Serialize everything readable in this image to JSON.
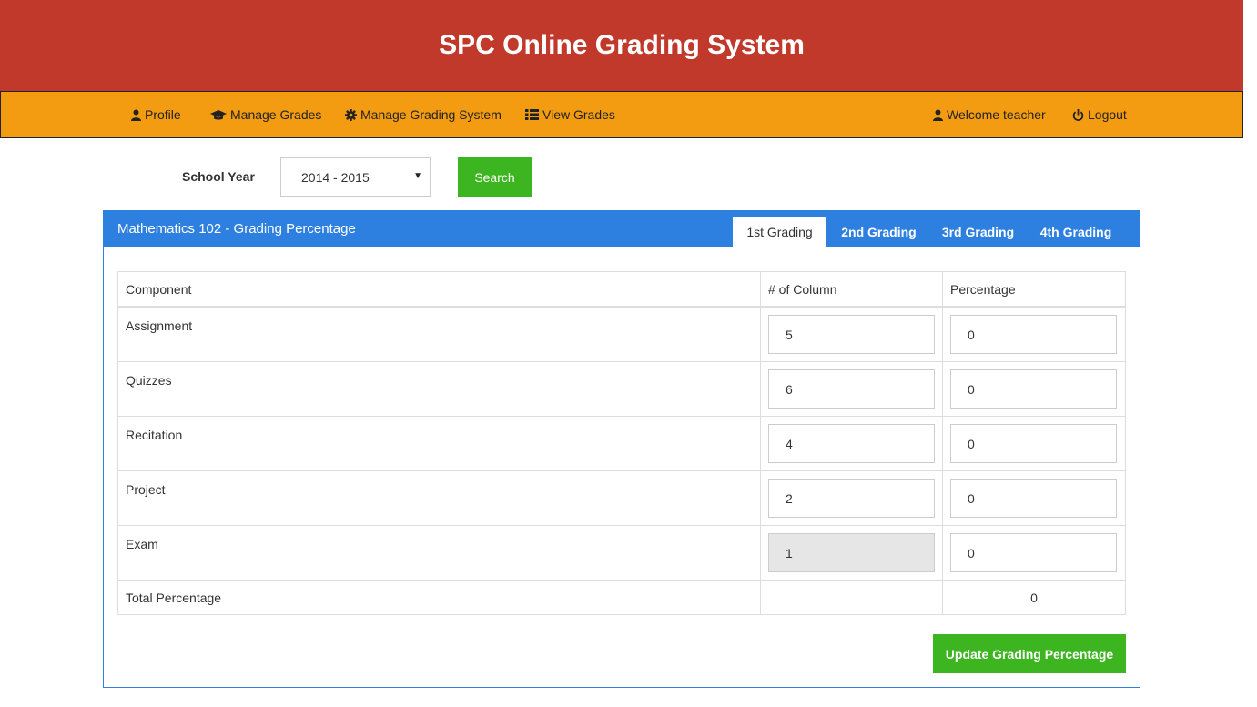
{
  "header": {
    "title": "SPC Online Grading System"
  },
  "nav": {
    "profile": "Profile",
    "manage_grades": "Manage Grades",
    "manage_grading_system": "Manage Grading System",
    "view_grades": "View Grades",
    "welcome": "Welcome teacher",
    "logout": "Logout"
  },
  "filter": {
    "school_year_label": "School Year",
    "school_year_value": "2014 - 2015",
    "search_label": "Search"
  },
  "panel": {
    "title": "Mathematics 102 - Grading Percentage",
    "tabs": [
      "1st Grading",
      "2nd Grading",
      "3rd Grading",
      "4th Grading"
    ],
    "active_tab": "1st Grading"
  },
  "table": {
    "headers": [
      "Component",
      "# of Column",
      "Percentage"
    ],
    "rows": [
      {
        "component": "Assignment",
        "columns": "5",
        "percentage": "0"
      },
      {
        "component": "Quizzes",
        "columns": "6",
        "percentage": "0"
      },
      {
        "component": "Recitation",
        "columns": "4",
        "percentage": "0"
      },
      {
        "component": "Project",
        "columns": "2",
        "percentage": "0"
      },
      {
        "component": "Exam",
        "columns": "1",
        "percentage": "0"
      }
    ],
    "total_label": "Total Percentage",
    "total_value": "0"
  },
  "actions": {
    "update_label": "Update Grading Percentage"
  },
  "colors": {
    "header": "#c0392b",
    "navbar": "#f39c12",
    "panel": "#2d7fe0",
    "button": "#3cb521"
  }
}
